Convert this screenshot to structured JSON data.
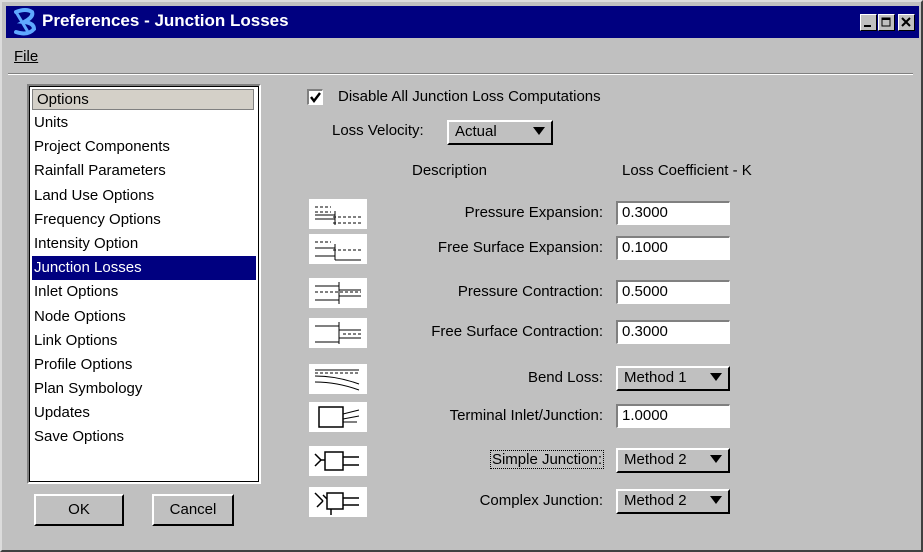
{
  "window": {
    "title": "Preferences - Junction Losses",
    "title_bg": "#000080",
    "controls": [
      "minimize-icon",
      "maximize-icon",
      "close-icon"
    ]
  },
  "menubar": {
    "file": "File"
  },
  "options_list": {
    "header": "Options",
    "items": [
      "Units",
      "Project Components",
      "Rainfall Parameters",
      "Land Use Options",
      "Frequency Options",
      "Intensity Option",
      "Junction Losses",
      "Inlet Options",
      "Node Options",
      "Link Options",
      "Profile Options",
      "Plan Symbology",
      "Updates",
      "Save Options"
    ],
    "selected": "Junction Losses",
    "selected_color": "#000080"
  },
  "buttons": {
    "ok": "OK",
    "cancel": "Cancel"
  },
  "settings": {
    "disable_label": "Disable All Junction Loss Computations",
    "disable_checked": true,
    "loss_velocity_label": "Loss Velocity:",
    "loss_velocity_value": "Actual",
    "col_description": "Description",
    "col_coefficient": "Loss Coefficient - K"
  },
  "rows": [
    {
      "label": "Pressure Expansion:",
      "kind": "input",
      "value": "0.3000",
      "icon": "pressure-expansion-icon"
    },
    {
      "label": "Free Surface Expansion:",
      "kind": "input",
      "value": "0.1000",
      "icon": "free-surface-expansion-icon"
    },
    {
      "label": "Pressure Contraction:",
      "kind": "input",
      "value": "0.5000",
      "icon": "pressure-contraction-icon"
    },
    {
      "label": "Free Surface Contraction:",
      "kind": "input",
      "value": "0.3000",
      "icon": "free-surface-contraction-icon"
    },
    {
      "label": "Bend Loss:",
      "kind": "select",
      "value": "Method 1",
      "icon": "bend-loss-icon"
    },
    {
      "label": "Terminal Inlet/Junction:",
      "kind": "input",
      "value": "1.0000",
      "icon": "terminal-inlet-icon"
    },
    {
      "label": "Simple Junction:",
      "kind": "select",
      "value": "Method 2",
      "icon": "simple-junction-icon"
    },
    {
      "label": "Complex Junction:",
      "kind": "select",
      "value": "Method 2",
      "icon": "complex-junction-icon"
    }
  ]
}
